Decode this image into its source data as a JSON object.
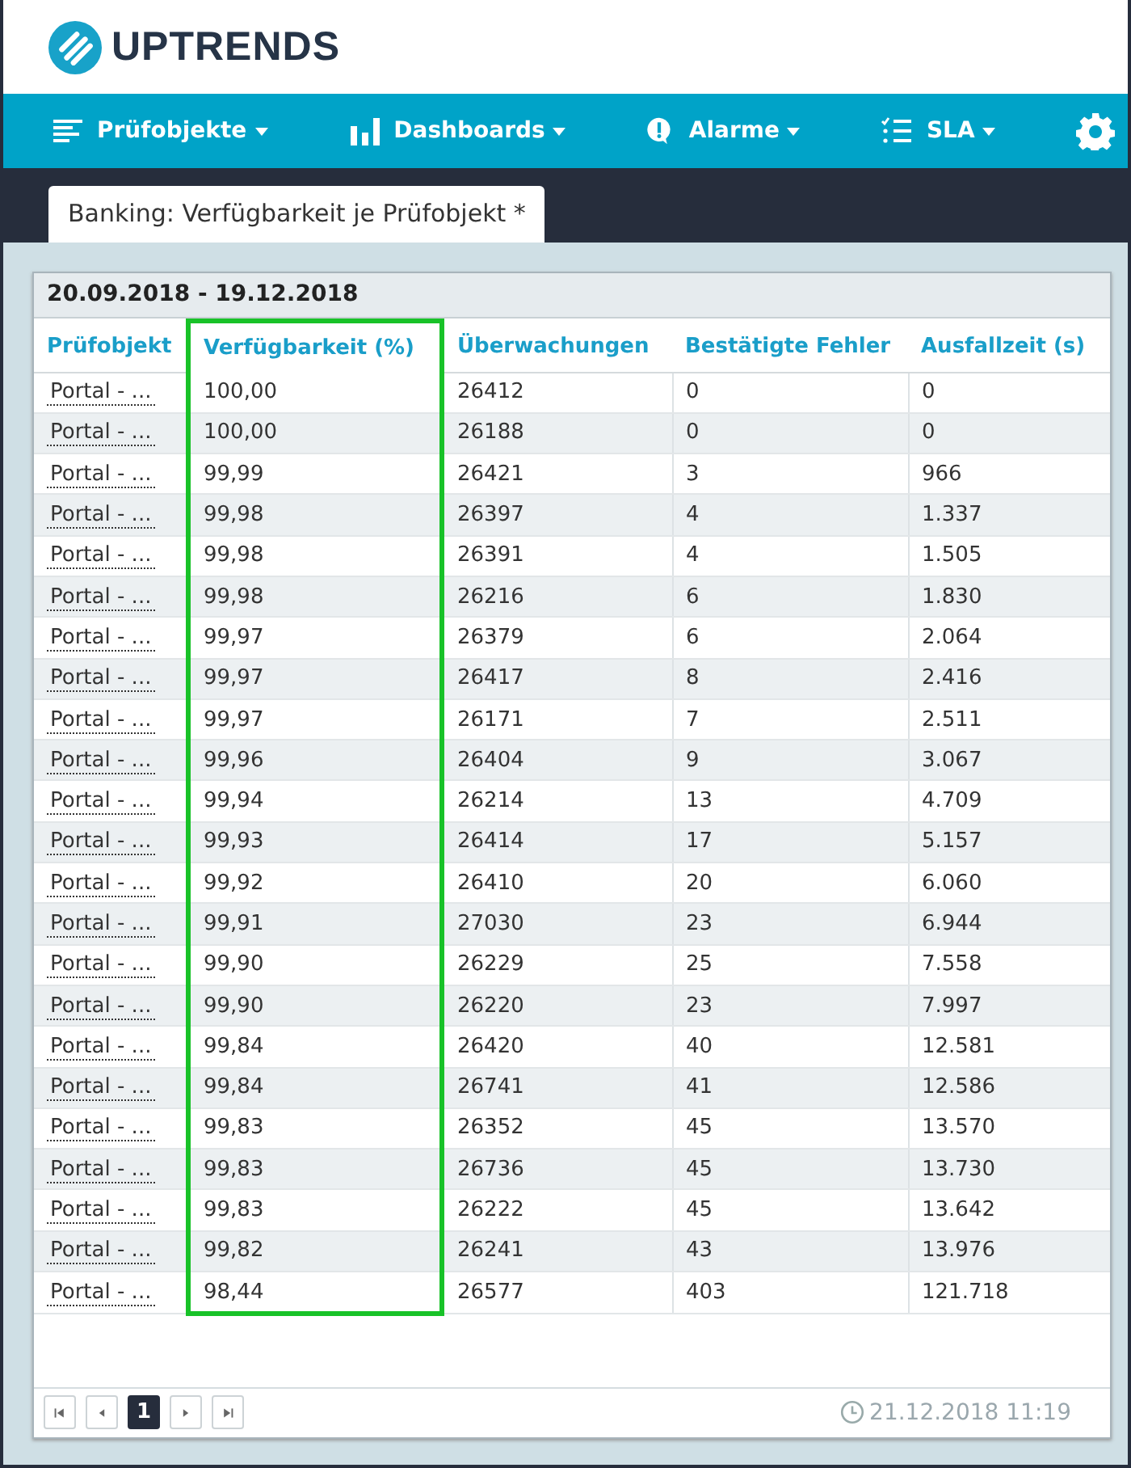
{
  "logo": {
    "text": "UPTRENDS"
  },
  "nav": [
    {
      "kind": "menu",
      "label": "Prüfobjekte"
    },
    {
      "kind": "menu",
      "label": "Dashboards"
    },
    {
      "kind": "menu",
      "label": "Alarme"
    },
    {
      "kind": "menu",
      "label": "SLA"
    },
    {
      "kind": "settings"
    }
  ],
  "tab": {
    "label": "Banking: Verfügbarkeit je Prüfobjekt *",
    "selected": true
  },
  "report": {
    "date_range": "20.09.2018 - 19.12.2018",
    "columns": [
      {
        "label": "Prüfobjekt",
        "highlighted": false
      },
      {
        "label": "Verfügbarkeit (%)",
        "highlighted": true
      },
      {
        "label": "Überwachungen",
        "highlighted": false
      },
      {
        "label": "Bestätigte Fehler",
        "highlighted": false
      },
      {
        "label": "Ausfallzeit (s)",
        "highlighted": false
      }
    ],
    "rows": [
      [
        "Portal - ...",
        "100,00",
        "26412",
        "0",
        "0"
      ],
      [
        "Portal - ...",
        "100,00",
        "26188",
        "0",
        "0"
      ],
      [
        "Portal - ...",
        "99,99",
        "26421",
        "3",
        "966"
      ],
      [
        "Portal - ...",
        "99,98",
        "26397",
        "4",
        "1.337"
      ],
      [
        "Portal - ...",
        "99,98",
        "26391",
        "4",
        "1.505"
      ],
      [
        "Portal - ...",
        "99,98",
        "26216",
        "6",
        "1.830"
      ],
      [
        "Portal - ...",
        "99,97",
        "26379",
        "6",
        "2.064"
      ],
      [
        "Portal - ...",
        "99,97",
        "26417",
        "8",
        "2.416"
      ],
      [
        "Portal - ...",
        "99,97",
        "26171",
        "7",
        "2.511"
      ],
      [
        "Portal - ...",
        "99,96",
        "26404",
        "9",
        "3.067"
      ],
      [
        "Portal - ...",
        "99,94",
        "26214",
        "13",
        "4.709"
      ],
      [
        "Portal - ...",
        "99,93",
        "26414",
        "17",
        "5.157"
      ],
      [
        "Portal - ...",
        "99,92",
        "26410",
        "20",
        "6.060"
      ],
      [
        "Portal - ...",
        "99,91",
        "27030",
        "23",
        "6.944"
      ],
      [
        "Portal - ...",
        "99,90",
        "26229",
        "25",
        "7.558"
      ],
      [
        "Portal - ...",
        "99,90",
        "26220",
        "23",
        "7.997"
      ],
      [
        "Portal - ...",
        "99,84",
        "26420",
        "40",
        "12.581"
      ],
      [
        "Portal - ...",
        "99,84",
        "26741",
        "41",
        "12.586"
      ],
      [
        "Portal - ...",
        "99,83",
        "26352",
        "45",
        "13.570"
      ],
      [
        "Portal - ...",
        "99,83",
        "26736",
        "45",
        "13.730"
      ],
      [
        "Portal - ...",
        "99,83",
        "26222",
        "45",
        "13.642"
      ],
      [
        "Portal - ...",
        "99,82",
        "26241",
        "43",
        "13.976"
      ],
      [
        "Portal - ...",
        "98,44",
        "26577",
        "403",
        "121.718"
      ]
    ],
    "pager": [
      {
        "kind": "first"
      },
      {
        "kind": "prev"
      },
      {
        "kind": "page",
        "label": "1",
        "selected": true
      },
      {
        "kind": "next"
      },
      {
        "kind": "last"
      }
    ],
    "timestamp": "21.12.2018 11:19"
  }
}
